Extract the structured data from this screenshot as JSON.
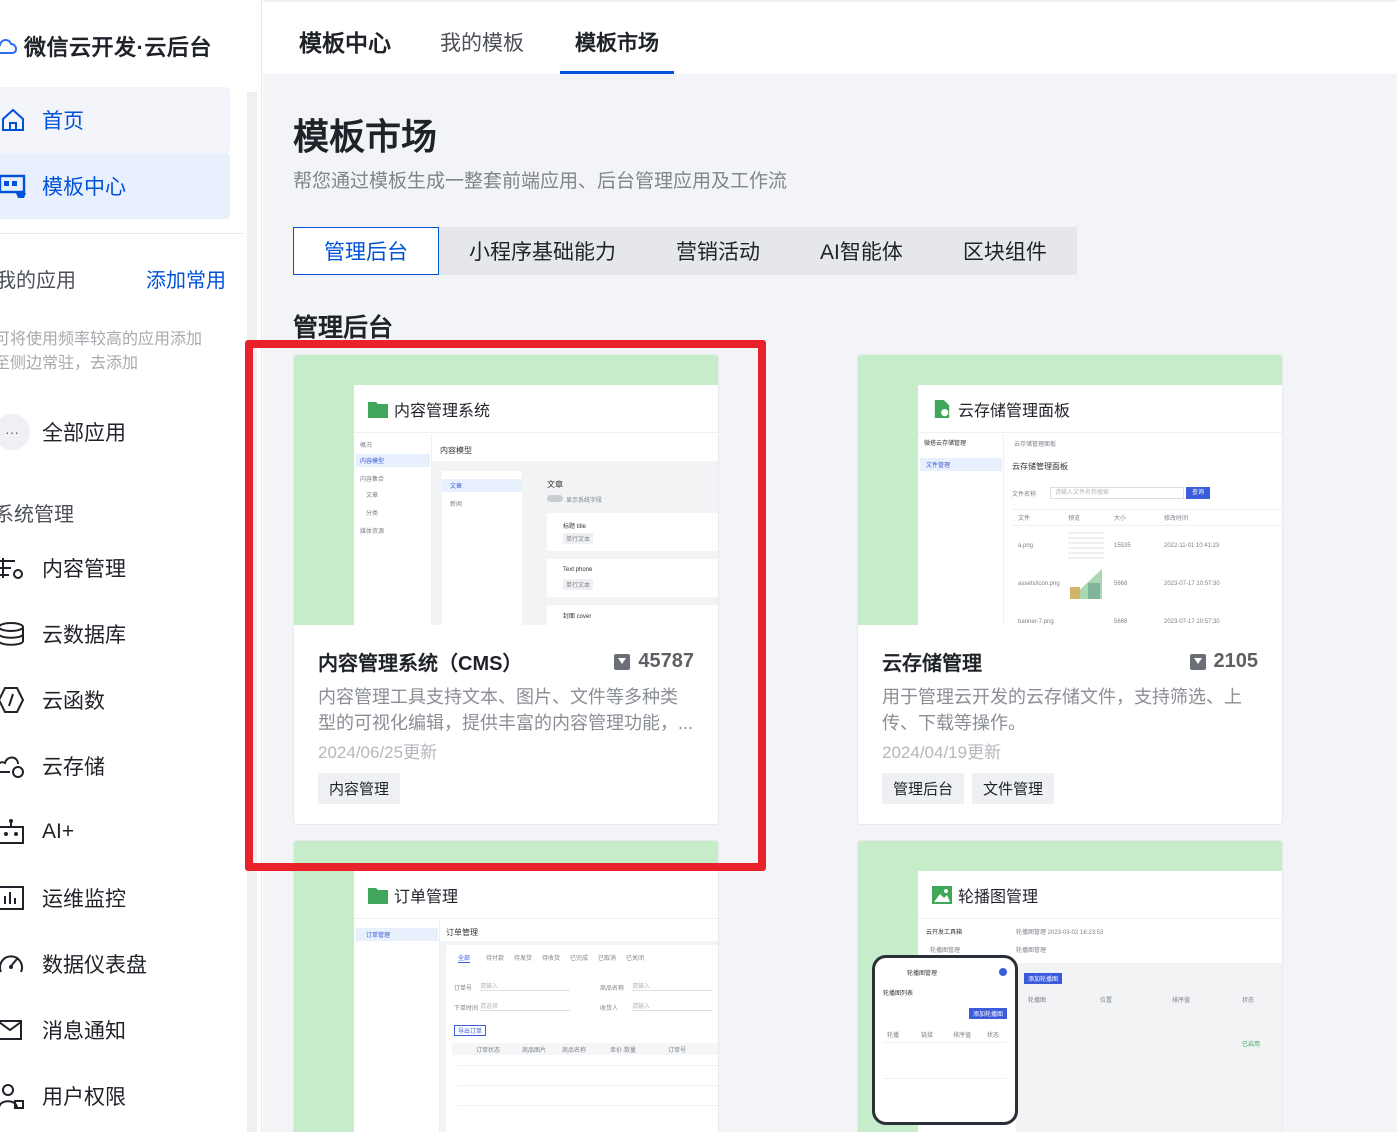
{
  "sidebar": {
    "brand": "微信云开发·云后台",
    "nav": [
      {
        "label": "首页",
        "icon": "home-icon"
      },
      {
        "label": "模板中心",
        "icon": "template-store-icon"
      }
    ],
    "my_apps_label": "我的应用",
    "add_common_label": "添加常用",
    "hint": "可将使用频率较高的应用添加至侧边常驻，去添加",
    "all_apps": {
      "label": "全部应用",
      "dots": "···"
    },
    "system_title": "系统管理",
    "system_items": [
      {
        "label": "内容管理",
        "icon": "content-management-icon"
      },
      {
        "label": "云数据库",
        "icon": "database-icon"
      },
      {
        "label": "云函数",
        "icon": "function-icon"
      },
      {
        "label": "云存储",
        "icon": "cloud-storage-icon"
      },
      {
        "label": "AI+",
        "icon": "robot-icon"
      },
      {
        "label": "运维监控",
        "icon": "monitor-chart-icon"
      },
      {
        "label": "数据仪表盘",
        "icon": "dashboard-gauge-icon"
      },
      {
        "label": "消息通知",
        "icon": "message-icon"
      },
      {
        "label": "用户权限",
        "icon": "user-permission-icon"
      }
    ]
  },
  "top_tabs": [
    {
      "label": "模板中心"
    },
    {
      "label": "我的模板"
    },
    {
      "label": "模板市场"
    }
  ],
  "page": {
    "title": "模板市场",
    "subtitle": "帮您通过模板生成一整套前端应用、后台管理应用及工作流",
    "categories": [
      "管理后台",
      "小程序基础能力",
      "营销活动",
      "AI智能体",
      "区块组件"
    ],
    "selected_category": "管理后台",
    "section_title": "管理后台"
  },
  "cards": [
    {
      "preview_title": "内容管理系统",
      "name": "内容管理系统（CMS）",
      "count": "45787",
      "desc": "内容管理工具支持文本、图片、文件等多种类型的可视化编辑，提供丰富的内容管理功能，...",
      "date": "2024/06/25更新",
      "tags": [
        "内容管理"
      ],
      "mini": {
        "side": [
          "概况",
          "内容模型",
          "内容集合",
          "文章",
          "分类",
          "媒体资源"
        ],
        "header": "内容模型",
        "list": [
          "文章",
          "新闻"
        ],
        "detail_title": "文章",
        "toggle": "显示系统字段",
        "fields": [
          "标题 title",
          "Text phone",
          "封面 cover"
        ],
        "field_tags": [
          "单行文本",
          "单行文本"
        ]
      }
    },
    {
      "preview_title": "云存储管理面板",
      "name": "云存储管理",
      "count": "2105",
      "desc": "用于管理云开发的云存储文件，支持筛选、上传、下载等操作。",
      "date": "2024/04/19更新",
      "tags": [
        "管理后台",
        "文件管理"
      ],
      "mini": {
        "side_top": "微搭云存储管理",
        "side_item": "文件管理",
        "crumb": "云存储管理面板",
        "header": "云存储管理面板",
        "filter_label": "文件名称",
        "filter_placeholder": "请输入文件名称搜索",
        "btn": "查询",
        "cols": [
          "文件",
          "预览",
          "大小",
          "修改时间"
        ],
        "rows": [
          [
            "a.png",
            "15535",
            "2022-11-01 10:41:23"
          ],
          [
            "assets/icon.png",
            "5668",
            "2023-07-17 10:57:30"
          ],
          [
            "banner-7.png",
            "5668",
            "2023-07-17 10:57:30"
          ]
        ]
      }
    },
    {
      "preview_title": "订单管理",
      "name": "",
      "mini": {
        "side": "订单管理",
        "header": "订单管理",
        "tabs": [
          "全部",
          "待付款",
          "待发货",
          "待收货",
          "已完成",
          "已取消",
          "已关闭"
        ],
        "labels": [
          "订单号",
          "商品名称",
          "下单时间",
          "收货人"
        ],
        "placeholders": [
          "请输入",
          "请选择"
        ],
        "btn": "导出订单",
        "cols": [
          "订单状态",
          "商品图片",
          "商品名称",
          "单价·数量",
          "订单号"
        ]
      }
    },
    {
      "preview_title": "轮播图管理",
      "name": "",
      "mini": {
        "side": "云开发工具箱",
        "side_item": "轮播图管理",
        "crumb": "轮播图管理 2023-03-02 16:23:53",
        "header": "轮播图管理",
        "btn": "添加轮播图",
        "cols": [
          "轮播图",
          "位置",
          "排序值",
          "状态"
        ],
        "status": "已启用",
        "phone_title": "轮播图管理",
        "phone_sub": "轮播图列表",
        "phone_btn": "添加轮播图",
        "phone_cols": [
          "轮播",
          "链接",
          "排序值",
          "状态"
        ]
      }
    }
  ]
}
